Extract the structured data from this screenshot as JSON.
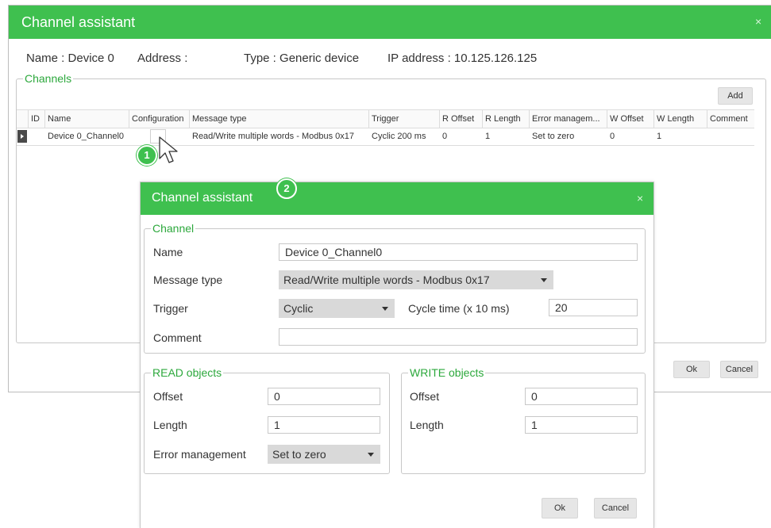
{
  "outer": {
    "title": "Channel assistant",
    "close": "×",
    "name_info": "Name : Device 0",
    "address_info": "Address :",
    "type_info": "Type : Generic device",
    "ip_info": "IP address : 10.125.126.125",
    "channels_legend": "Channels",
    "add_label": "Add",
    "ok_label": "Ok",
    "cancel_label": "Cancel"
  },
  "table": {
    "headers": [
      "ID",
      "Name",
      "Configuration",
      "Message type",
      "Trigger",
      "R Offset",
      "R Length",
      "Error managem...",
      "W Offset",
      "W Length",
      "Comment"
    ],
    "rows": [
      {
        "id": "",
        "name": "Device 0_Channel0",
        "configuration": "",
        "message_type": "Read/Write multiple words - Modbus 0x17",
        "trigger": "Cyclic 200 ms",
        "r_offset": "0",
        "r_length": "1",
        "error_management": "Set to zero",
        "w_offset": "0",
        "w_length": "1",
        "comment": ""
      }
    ]
  },
  "callouts": {
    "one": "1",
    "two": "2"
  },
  "inner": {
    "title": "Channel assistant",
    "close": "×",
    "channel_legend": "Channel",
    "name_label": "Name",
    "name_value": "Device 0_Channel0",
    "message_type_label": "Message type",
    "message_type_value": "Read/Write multiple words - Modbus 0x17",
    "trigger_label": "Trigger",
    "trigger_value": "Cyclic",
    "cycle_time_label": "Cycle time (x 10 ms)",
    "cycle_time_value": "20",
    "comment_label": "Comment",
    "comment_value": "",
    "read_legend": "READ objects",
    "read_offset_label": "Offset",
    "read_offset_value": "0",
    "read_length_label": "Length",
    "read_length_value": "1",
    "error_label": "Error management",
    "error_value": "Set to zero",
    "write_legend": "WRITE objects",
    "write_offset_label": "Offset",
    "write_offset_value": "0",
    "write_length_label": "Length",
    "write_length_value": "1",
    "ok_label": "Ok",
    "cancel_label": "Cancel"
  },
  "colors": {
    "accent": "#3fc04f",
    "legend": "#2ca83c",
    "select_bg": "#d9d9d9"
  }
}
